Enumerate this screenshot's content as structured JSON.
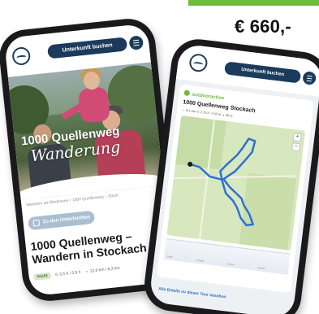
{
  "price": "€ 660,-",
  "left_phone": {
    "header": {
      "book_label": "Unterkunft buchen"
    },
    "hero": {
      "title_line1": "1000 Quellenweg",
      "title_line2": "Wanderung"
    },
    "breadcrumb": "Wandern am Bodensee   ›   1000 Quellenweg – Stock",
    "lodging_button": "Zu den Unterkünften",
    "headline": "1000 Quellenweg – Wandern in Stockach",
    "meta": {
      "difficulty": "leicht",
      "duration": "⊙ 3,5 h / 3,5 h",
      "distance": "⇔ 12,9 km / 6,3 km"
    }
  },
  "right_phone": {
    "header": {
      "book_label": "Unterkunft buchen"
    },
    "brand": "outdooractive",
    "tour_title": "1000 Quellenweg Stockach",
    "stats": "↔ 8,1 km  ⊙ 2:15 h  ↗ 56 m  ↘ 46 m",
    "map_ctrls": {
      "plus": "+",
      "minus": "−"
    },
    "profile_ticks": [
      "0 km",
      "1,0 km",
      "2,0 km",
      "3,0 km"
    ],
    "details_link": "Alle Details zu dieser Tour ansehen"
  },
  "colors": {
    "brand_green": "#6cbb3c",
    "navy": "#1b3a5c",
    "route_blue": "#2f6fd6"
  }
}
